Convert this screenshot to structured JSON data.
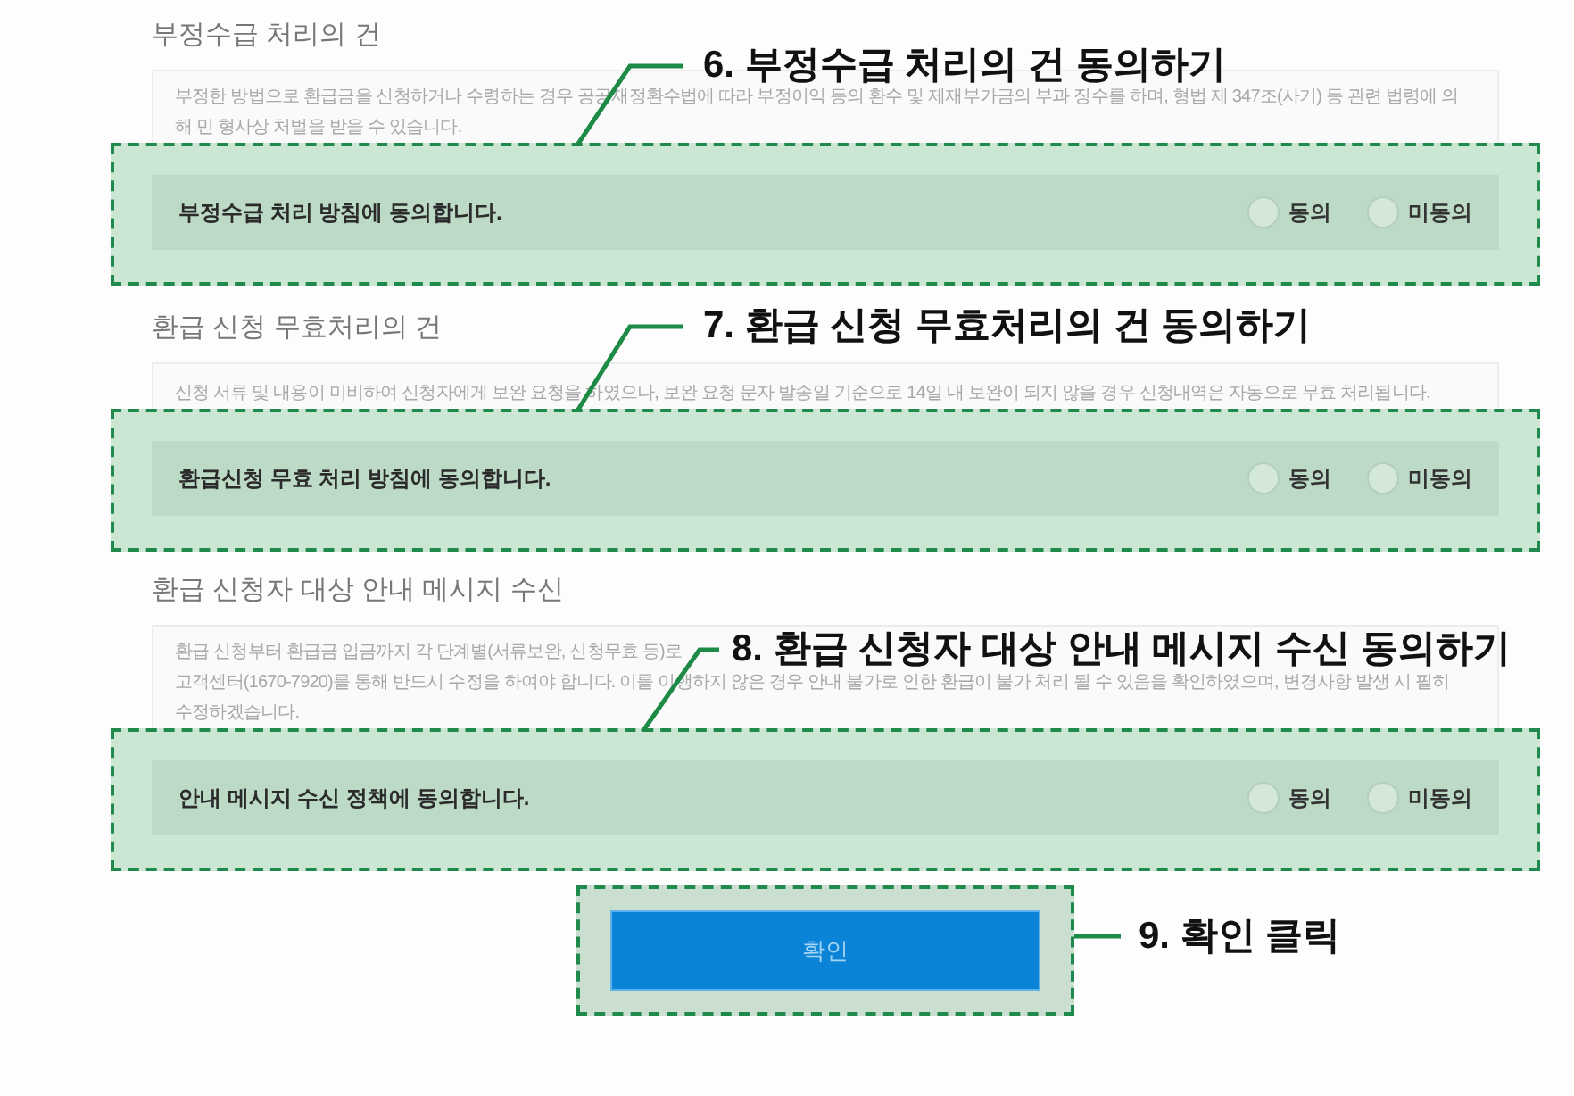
{
  "sections": [
    {
      "title": "부정수급 처리의 건",
      "description": [
        "부정한 방법으로 환급금을 신청하거나 수령하는 경우 공공재정환수법에 따라 부정이익 등의 환수 및 제재부가금의 부과 징수를 하며, 형법 제 347조(사기) 등 관련 법령에 의",
        "해 민 형사상 처벌을 받을 수 있습니다."
      ],
      "agreement": {
        "label": "부정수급 처리 방침에 동의합니다.",
        "options": [
          {
            "label": "동의",
            "selected": false
          },
          {
            "label": "미동의",
            "selected": false
          }
        ]
      },
      "callout": "6. 부정수급 처리의 건 동의하기"
    },
    {
      "title": "환급 신청 무효처리의 건",
      "description": [
        "신청 서류 및 내용이 미비하여 신청자에게 보완 요청을 하였으나, 보완 요청 문자 발송일 기준으로 14일 내 보완이 되지 않을 경우 신청내역은 자동으로 무효 처리됩니다."
      ],
      "agreement": {
        "label": "환급신청 무효 처리 방침에 동의합니다.",
        "options": [
          {
            "label": "동의",
            "selected": false
          },
          {
            "label": "미동의",
            "selected": false
          }
        ]
      },
      "callout": "7. 환급 신청 무효처리의 건 동의하기"
    },
    {
      "title": "환급 신청자 대상 안내 메시지 수신",
      "description": [
        "환급 신청부터 환급금 입금까지 각 단계별(서류보완, 신청무효 등)로",
        "고객센터(1670-7920)를 통해 반드시 수정을 하여야 합니다. 이를 이행하지 않은 경우 안내 불가로 인한 환급이 불가 처리 될 수 있음을 확인하였으며, 변경사항 발생 시 필히",
        "수정하겠습니다."
      ],
      "agreement": {
        "label": "안내 메시지 수신 정책에 동의합니다.",
        "options": [
          {
            "label": "동의",
            "selected": false
          },
          {
            "label": "미동의",
            "selected": false
          }
        ]
      },
      "callout": "8. 환급 신청자 대상 안내 메시지 수신 동의하기"
    }
  ],
  "confirm": {
    "label": "확인",
    "callout": "9. 확인 클릭"
  }
}
